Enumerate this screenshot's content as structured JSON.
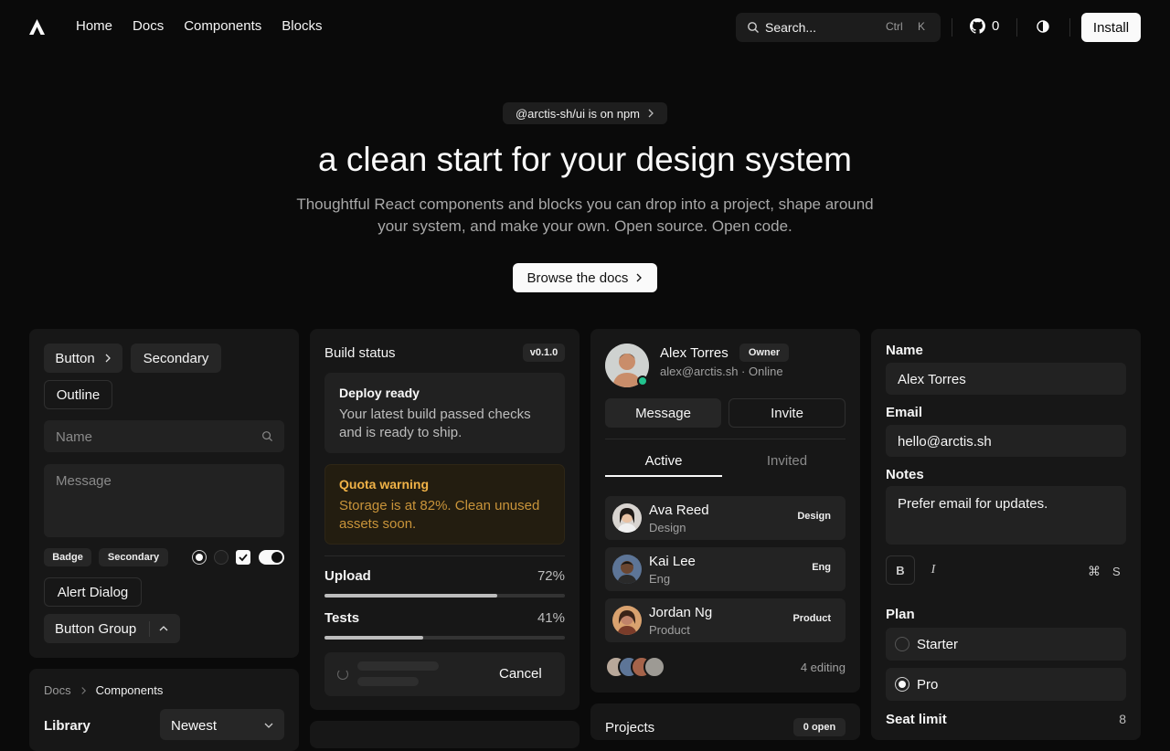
{
  "nav": {
    "logo_icon": "arctis-logo-icon",
    "links": [
      "Home",
      "Docs",
      "Components",
      "Blocks"
    ],
    "search_placeholder": "Search...",
    "search_kbd": [
      "Ctrl",
      "K"
    ],
    "github_count": "0",
    "install_label": "Install"
  },
  "hero": {
    "pill": "@arctis-sh/ui is on npm",
    "title": "a clean start for your design system",
    "subtitle": "Thoughtful React components and blocks you can drop into a project, shape around your system, and make your own. Open source. Open code.",
    "cta": "Browse the docs"
  },
  "components_card": {
    "button": "Button",
    "secondary": "Secondary",
    "outline": "Outline",
    "name_placeholder": "Name",
    "message_placeholder": "Message",
    "badge": "Badge",
    "badge_secondary": "Secondary",
    "alert_dialog": "Alert Dialog",
    "button_group": "Button Group"
  },
  "breadcrumb_card": {
    "crumbs": [
      "Docs",
      "Components"
    ],
    "library_label": "Library",
    "sort_value": "Newest"
  },
  "build_card": {
    "title": "Build status",
    "version": "v0.1.0",
    "deploy_title": "Deploy ready",
    "deploy_text": "Your latest build passed checks and is ready to ship.",
    "quota_title": "Quota warning",
    "quota_text": "Storage is at 82%. Clean unused assets soon.",
    "upload_label": "Upload",
    "upload_pct": "72%",
    "upload_value": 0.72,
    "tests_label": "Tests",
    "tests_pct": "41%",
    "tests_value": 0.41,
    "cancel": "Cancel"
  },
  "profile_card": {
    "name": "Alex Torres",
    "role_badge": "Owner",
    "meta": "alex@arctis.sh · Online",
    "message_btn": "Message",
    "invite_btn": "Invite",
    "tabs": [
      "Active",
      "Invited"
    ],
    "members": [
      {
        "name": "Ava Reed",
        "team": "Design",
        "tag": "Design"
      },
      {
        "name": "Kai Lee",
        "team": "Eng",
        "tag": "Eng"
      },
      {
        "name": "Jordan Ng",
        "team": "Product",
        "tag": "Product"
      }
    ],
    "editing": "4 editing"
  },
  "projects_card": {
    "title": "Projects",
    "badge": "0 open"
  },
  "form_card": {
    "name_label": "Name",
    "name_value": "Alex Torres",
    "email_label": "Email",
    "email_value": "hello@arctis.sh",
    "notes_label": "Notes",
    "notes_value": "Prefer email for updates.",
    "bold": "B",
    "italic": "I",
    "shortcut": "⌘",
    "shortcut_key": "S",
    "plan_label": "Plan",
    "plans": [
      "Starter",
      "Pro"
    ],
    "selected_plan": "Pro",
    "seat_label": "Seat limit",
    "seat_value": "8"
  }
}
